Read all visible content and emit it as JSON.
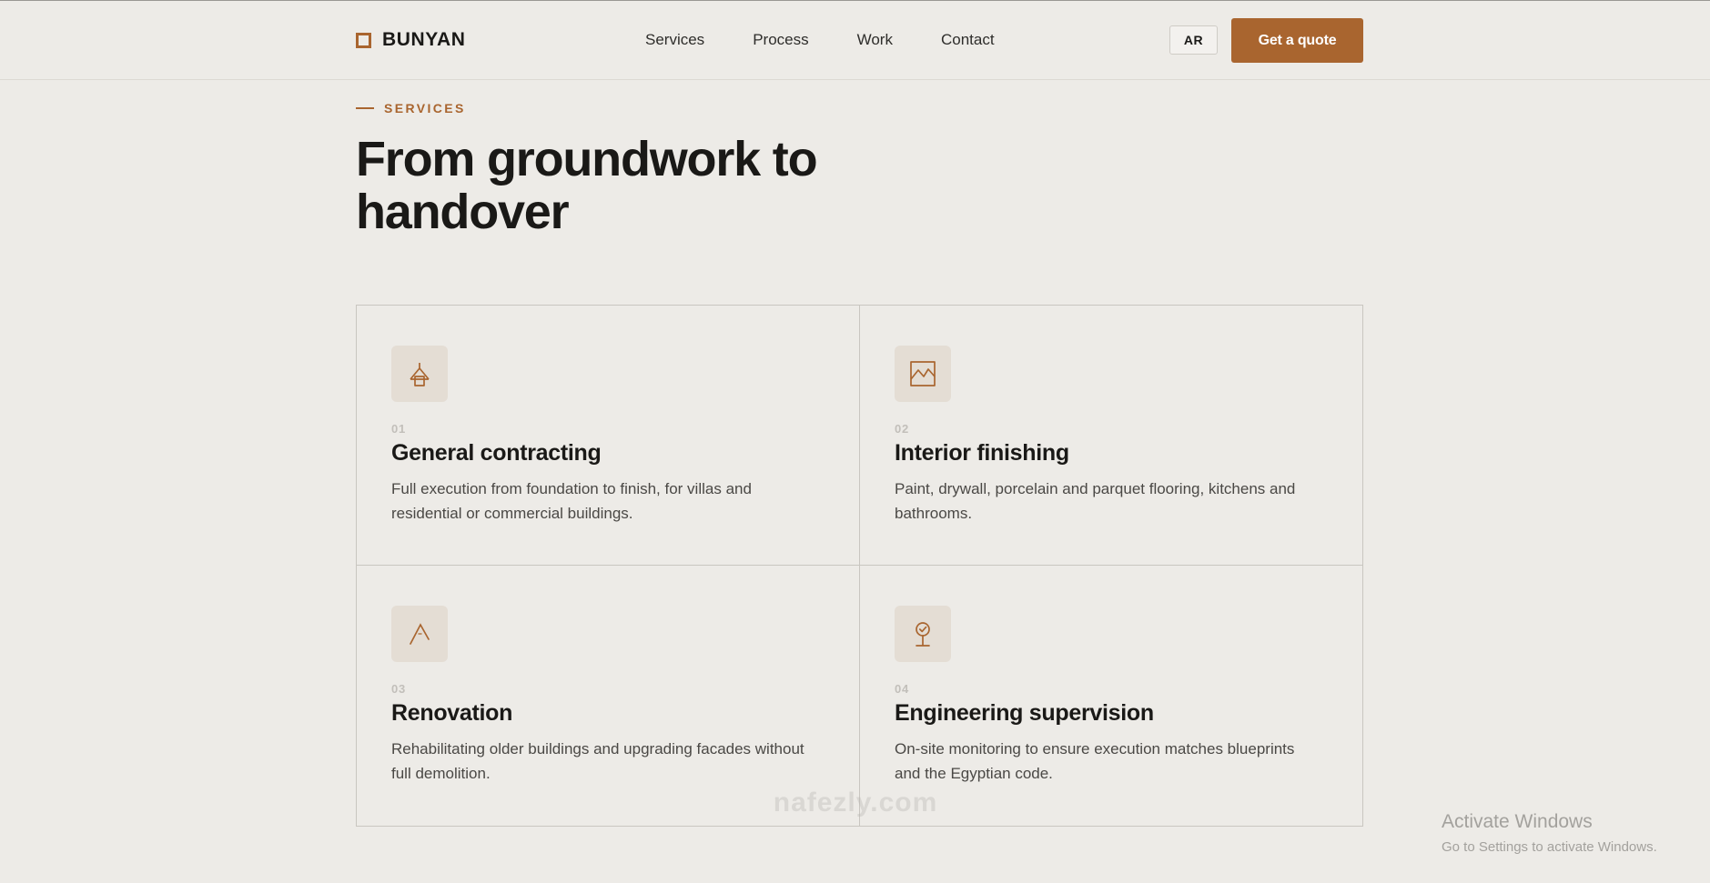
{
  "header": {
    "brand": "BUNYAN",
    "nav": [
      "Services",
      "Process",
      "Work",
      "Contact"
    ],
    "lang_label": "AR",
    "cta_label": "Get a quote"
  },
  "hero": {
    "eyebrow": "SERVICES",
    "title": "From groundwork to handover"
  },
  "services": [
    {
      "num": "01",
      "title": "General contracting",
      "desc": "Full execution from foundation to finish, for villas and residential or commercial buildings.",
      "icon": "house-frame-icon"
    },
    {
      "num": "02",
      "title": "Interior finishing",
      "desc": "Paint, drywall, porcelain and parquet flooring, kitchens and bathrooms.",
      "icon": "picture-frame-icon"
    },
    {
      "num": "03",
      "title": "Renovation",
      "desc": "Rehabilitating older buildings and upgrading facades without full demolition.",
      "icon": "compass-icon"
    },
    {
      "num": "04",
      "title": "Engineering supervision",
      "desc": "On-site monitoring to ensure execution matches blueprints and the Egyptian code.",
      "icon": "check-pin-icon"
    }
  ],
  "watermark": "nafezly.com",
  "os_notice": {
    "title": "Activate Windows",
    "subtitle": "Go to Settings to activate Windows."
  },
  "colors": {
    "accent": "#a9652f",
    "background": "#edebe7",
    "text": "#1a1917",
    "icon_bg": "#e4ddd4"
  }
}
